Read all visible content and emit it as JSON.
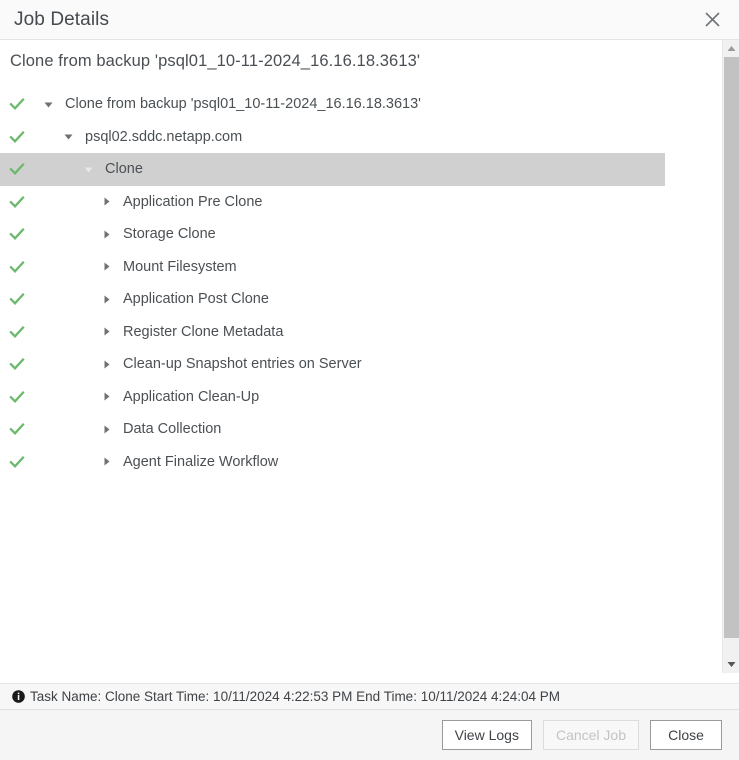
{
  "titlebar": {
    "title": "Job Details",
    "close_icon": "close-icon"
  },
  "subtitle": "Clone from backup 'psql01_10-11-2024_16.16.18.3613'",
  "colors": {
    "success_check": "#6cb86c",
    "selected_row": "#d0d0d0",
    "text": "#4b5054",
    "footer_bg": "#f5f5f5"
  },
  "tree": {
    "items": [
      {
        "label": "Clone from backup 'psql01_10-11-2024_16.16.18.3613'",
        "level": 0,
        "state": "success",
        "caret": "expanded",
        "selected": false
      },
      {
        "label": "psql02.sddc.netapp.com",
        "level": 1,
        "state": "success",
        "caret": "expanded",
        "selected": false
      },
      {
        "label": "Clone",
        "level": 2,
        "state": "success",
        "caret": "expanded",
        "selected": true
      },
      {
        "label": "Application Pre Clone",
        "level": 3,
        "state": "success",
        "caret": "collapsed",
        "selected": false
      },
      {
        "label": "Storage Clone",
        "level": 3,
        "state": "success",
        "caret": "collapsed",
        "selected": false
      },
      {
        "label": "Mount Filesystem",
        "level": 3,
        "state": "success",
        "caret": "collapsed",
        "selected": false
      },
      {
        "label": "Application Post Clone",
        "level": 3,
        "state": "success",
        "caret": "collapsed",
        "selected": false
      },
      {
        "label": "Register Clone Metadata",
        "level": 3,
        "state": "success",
        "caret": "collapsed",
        "selected": false
      },
      {
        "label": "Clean-up Snapshot entries on Server",
        "level": 3,
        "state": "success",
        "caret": "collapsed",
        "selected": false
      },
      {
        "label": "Application Clean-Up",
        "level": 3,
        "state": "success",
        "caret": "collapsed",
        "selected": false
      },
      {
        "label": "Data Collection",
        "level": 3,
        "state": "success",
        "caret": "collapsed",
        "selected": false
      },
      {
        "label": "Agent Finalize Workflow",
        "level": 3,
        "state": "success",
        "caret": "collapsed",
        "selected": false
      }
    ]
  },
  "statusbar": {
    "icon": "info-icon",
    "text": "Task Name: Clone Start Time: 10/11/2024 4:22:53 PM End Time: 10/11/2024 4:24:04 PM"
  },
  "footer": {
    "buttons": [
      {
        "label": "View Logs",
        "name": "view-logs-button",
        "disabled": false
      },
      {
        "label": "Cancel Job",
        "name": "cancel-job-button",
        "disabled": true
      },
      {
        "label": "Close",
        "name": "close-button",
        "disabled": false
      }
    ]
  },
  "scrollbar": {
    "up_arrow": "chevron-up-icon",
    "down_arrow": "chevron-down-icon"
  }
}
